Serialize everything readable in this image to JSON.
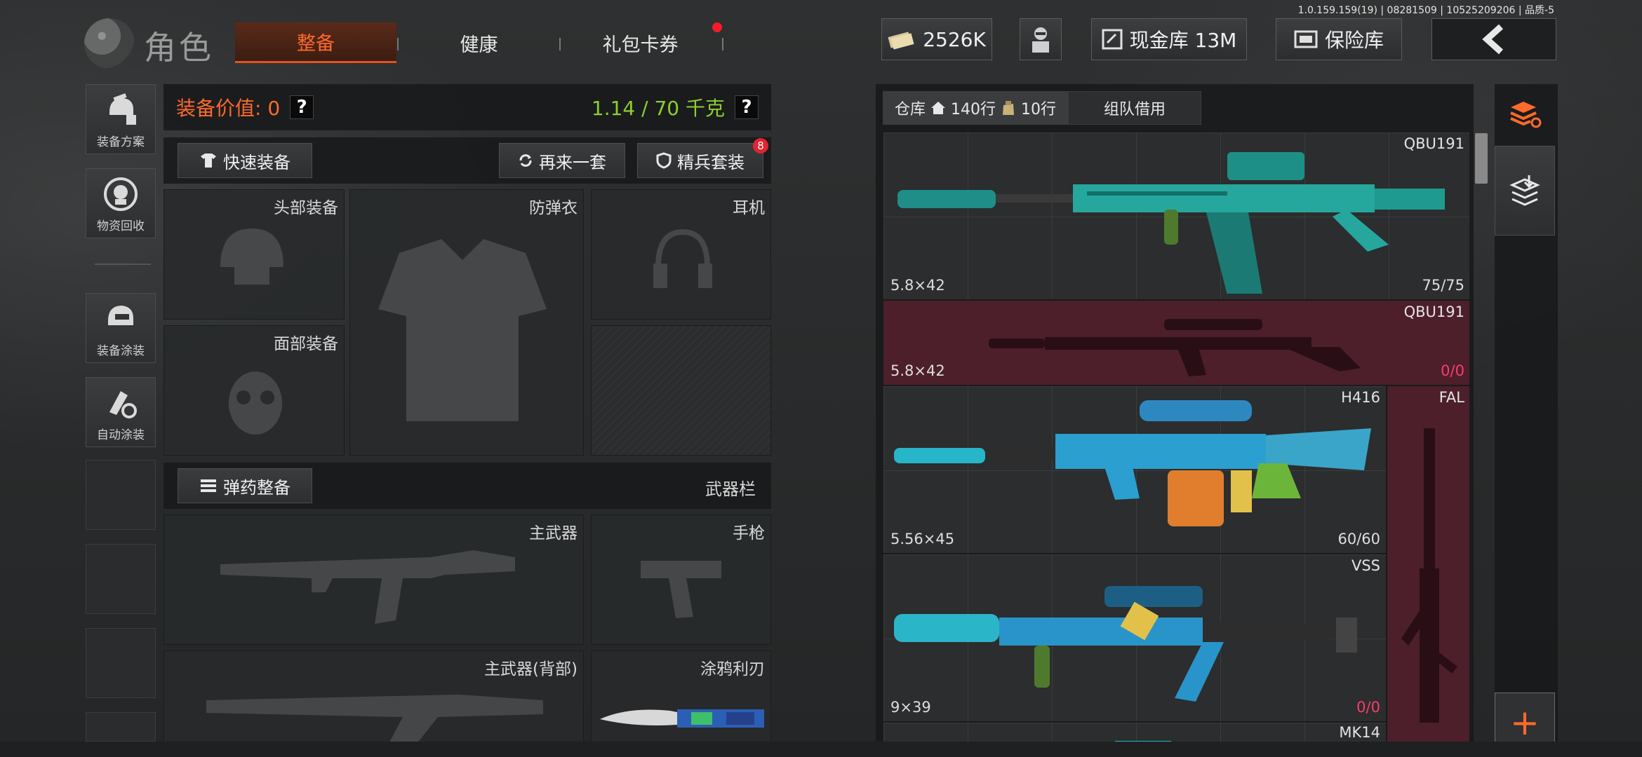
{
  "version": "1.0.159.159(19) | 08281509 | 10525209206 | 品质-5",
  "header": {
    "title": "角色",
    "tabs": [
      {
        "label": "整备",
        "active": true
      },
      {
        "label": "健康",
        "active": false
      },
      {
        "label": "礼包卡券",
        "active": false,
        "has_notice": true
      }
    ],
    "money": "2526K",
    "cash_vault": "现金库 13M",
    "safe": "保险库"
  },
  "sidebar": {
    "items": [
      {
        "label": "装备方案",
        "icon": "loadout-icon"
      },
      {
        "label": "物资回收",
        "icon": "recycle-icon"
      },
      {
        "label": "装备涂装",
        "icon": "skin-icon"
      },
      {
        "label": "自动涂装",
        "icon": "auto-paint-icon"
      }
    ]
  },
  "equipment": {
    "value_label": "装备价值:",
    "value": "0",
    "weight": "1.14 / 70 千克",
    "quick_equip": "快速装备",
    "again": "再来一套",
    "elite": "精兵套装",
    "elite_badge": "8",
    "slots": {
      "head": "头部装备",
      "armor": "防弹衣",
      "earphone": "耳机",
      "face": "面部装备",
      "ammo_btn": "弹药整备",
      "weapon_bar": "武器栏",
      "primary": "主武器",
      "pistol": "手枪",
      "primary_back": "主武器(背部)",
      "melee": "涂鸦利刃"
    }
  },
  "warehouse": {
    "tab_label": "仓库",
    "rows": "140行",
    "extra_rows": "10行",
    "team_tab": "组队借用",
    "items": [
      {
        "name": "QBU191",
        "caliber": "5.8×42",
        "ammo": "75",
        "ammo_max": "75"
      },
      {
        "name": "QBU191",
        "caliber": "5.8×42",
        "ammo": "0",
        "ammo_max": "0"
      },
      {
        "name": "H416",
        "caliber": "5.56×45",
        "ammo": "60",
        "ammo_max": "60"
      },
      {
        "name": "VSS",
        "caliber": "9×39",
        "ammo": "0",
        "ammo_max": "0"
      },
      {
        "name": "FAL"
      },
      {
        "name": "MK14"
      }
    ]
  },
  "colors": {
    "accent": "#ff6a2b",
    "weight_green": "#8ccf2e",
    "locked_red": "#5a2230",
    "badge_red": "#e2242f"
  }
}
